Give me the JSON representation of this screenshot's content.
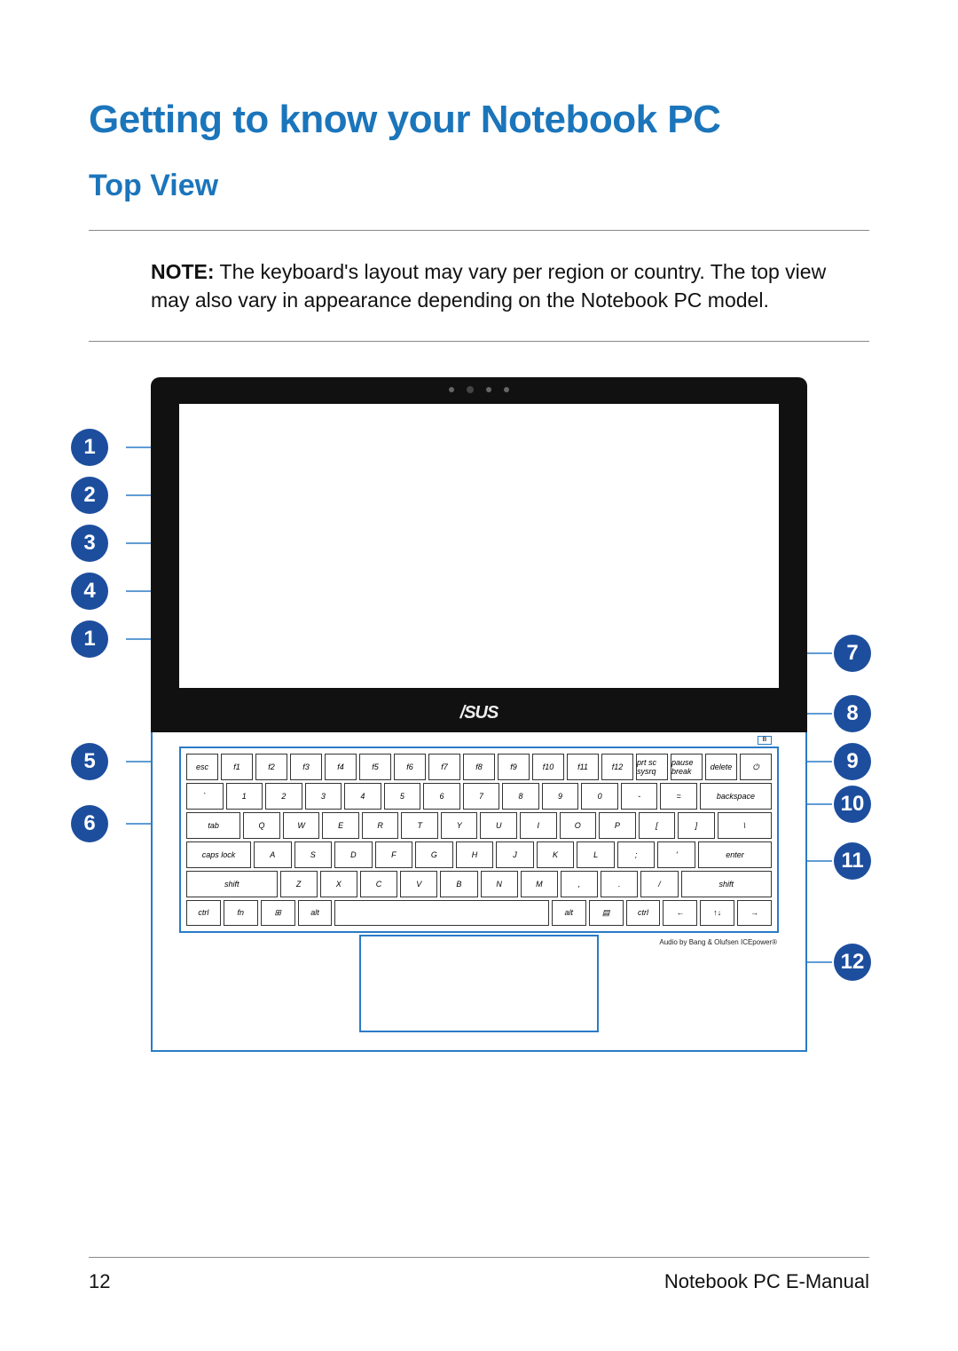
{
  "headings": {
    "main": "Getting to know your Notebook PC",
    "sub": "Top View"
  },
  "note": {
    "label": "NOTE:",
    "text": " The keyboard's layout may vary per region or country. The top view may also vary in appearance depending on the Notebook PC model."
  },
  "brand_logo": "/SUS",
  "audio_credit": "Audio by Bang & Olufsen ICEpower®",
  "callouts_left": [
    "1",
    "2",
    "3",
    "4",
    "1",
    "5",
    "6"
  ],
  "callouts_right": [
    "7",
    "8",
    "9",
    "10",
    "11",
    "12"
  ],
  "keyboard": {
    "row_fn": [
      "esc",
      "f1",
      "f2",
      "f3",
      "f4",
      "f5",
      "f6",
      "f7",
      "f8",
      "f9",
      "f10",
      "f11",
      "f12",
      "prt sc sysrq",
      "pause break",
      "delete",
      "⏻"
    ],
    "row_num": [
      "`",
      "1",
      "2",
      "3",
      "4",
      "5",
      "6",
      "7",
      "8",
      "9",
      "0",
      "-",
      "=",
      "backspace"
    ],
    "row_q": [
      "tab",
      "Q",
      "W",
      "E",
      "R",
      "T",
      "Y",
      "U",
      "I",
      "O",
      "P",
      "[",
      "]",
      "\\"
    ],
    "row_a": [
      "caps lock",
      "A",
      "S",
      "D",
      "F",
      "G",
      "H",
      "J",
      "K",
      "L",
      ";",
      "'",
      "enter"
    ],
    "row_z": [
      "shift",
      "Z",
      "X",
      "C",
      "V",
      "B",
      "N",
      "M",
      ",",
      ".",
      "/",
      "shift"
    ],
    "row_mod": [
      "ctrl",
      "fn",
      "⊞",
      "alt",
      "",
      "alt",
      "▤",
      "ctrl",
      "←",
      "↑↓",
      "→"
    ]
  },
  "footer": {
    "page": "12",
    "title": "Notebook PC E-Manual"
  }
}
